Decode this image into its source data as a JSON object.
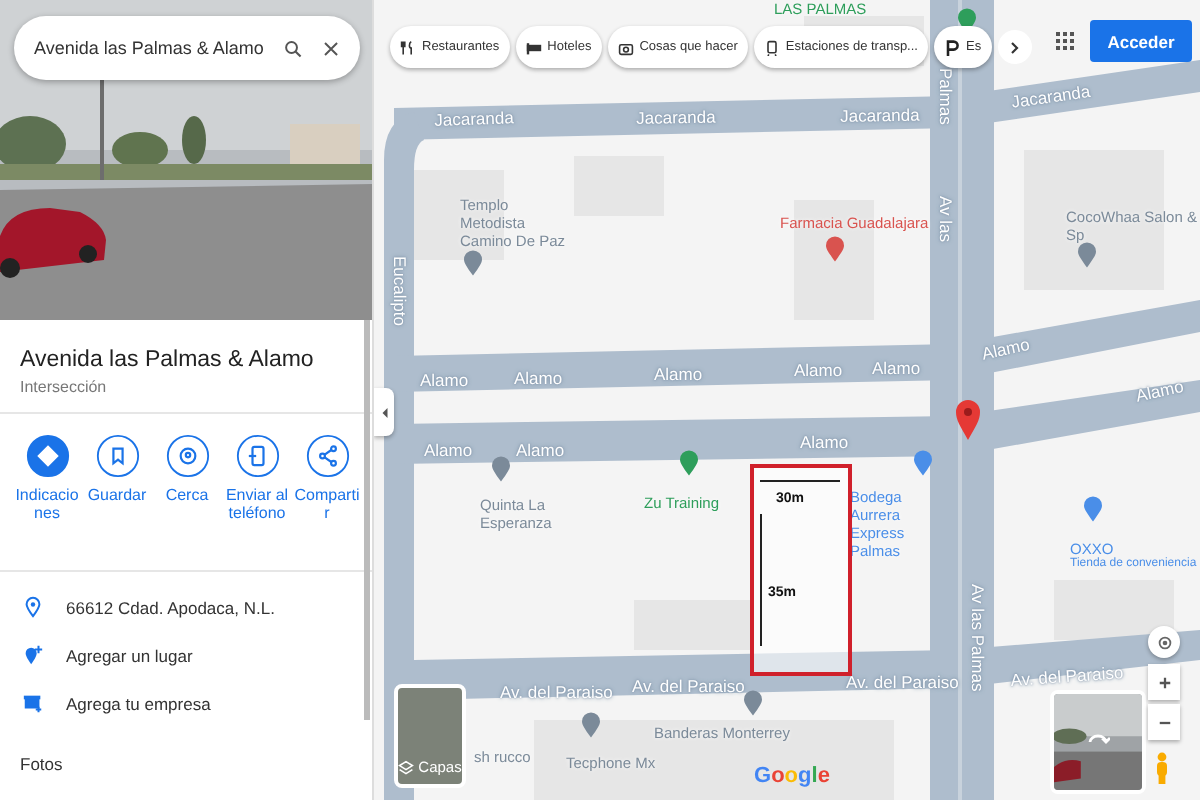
{
  "search": {
    "value": "Avenida las Palmas & Alamo"
  },
  "place": {
    "title": "Avenida las Palmas & Alamo",
    "subtitle": "Intersección"
  },
  "actions": [
    {
      "label": "Indicaciones",
      "kind": "directions",
      "selected": true
    },
    {
      "label": "Guardar",
      "kind": "save",
      "selected": false
    },
    {
      "label": "Cerca",
      "kind": "nearby",
      "selected": false
    },
    {
      "label": "Enviar al teléfono",
      "kind": "phone",
      "selected": false
    },
    {
      "label": "Compartir",
      "kind": "share",
      "selected": false
    }
  ],
  "info_rows": [
    {
      "text": "66612 Cdad. Apodaca, N.L.",
      "kind": "address"
    },
    {
      "text": "Agregar un lugar",
      "kind": "add-place"
    },
    {
      "text": "Agrega tu empresa",
      "kind": "business"
    }
  ],
  "photos_heading": "Fotos",
  "chips": [
    {
      "label": "Restaurantes",
      "kind": "restaurant"
    },
    {
      "label": "Hoteles",
      "kind": "hotel"
    },
    {
      "label": "Cosas que hacer",
      "kind": "camera"
    },
    {
      "label": "Estaciones de transp...",
      "kind": "transit"
    },
    {
      "label": "Es",
      "kind": "parking"
    }
  ],
  "sign_in": "Acceder",
  "streets": [
    "Jacaranda",
    "Jacaranda",
    "Jacaranda",
    "Jacaranda",
    "Alamo",
    "Alamo",
    "Alamo",
    "Alamo",
    "Alamo",
    "Alamo",
    "Alamo",
    "Alamo",
    "Alamo",
    "Alamo",
    "Av. del Paraiso",
    "Av. del Paraiso",
    "Av. del Paraiso",
    "Av. del Paraiso",
    "Palmas",
    "Av las",
    "Av las Palmas",
    "Eucalipto"
  ],
  "places": [
    {
      "name": "LAS PALMAS",
      "color": "#2e9e5b"
    },
    {
      "name": "Templo Metodista Camino De Paz",
      "color": "#7b8a99"
    },
    {
      "name": "Farmacia Guadalajara",
      "color": "#d9534f"
    },
    {
      "name": "CocoWhaa Salon & Sp",
      "color": "#7b8a99"
    },
    {
      "name": "Quinta La Esperanza",
      "color": "#7b8a99"
    },
    {
      "name": "Zu Training",
      "color": "#2e9e5b"
    },
    {
      "name": "Bodega Aurrera Express Palmas",
      "color": "#4a8ee8"
    },
    {
      "name": "OXXO",
      "color": "#4a8ee8",
      "note": "Tienda de conveniencia"
    },
    {
      "name": "Banderas Monterrey",
      "color": "#7b8a99"
    },
    {
      "name": "Tecphone Mx",
      "color": "#7b8a99"
    }
  ],
  "map_texts": [
    "sh rucco"
  ],
  "measurement": {
    "width": "30m",
    "height": "35m"
  },
  "layers_label": "Capas",
  "logo": "Google"
}
